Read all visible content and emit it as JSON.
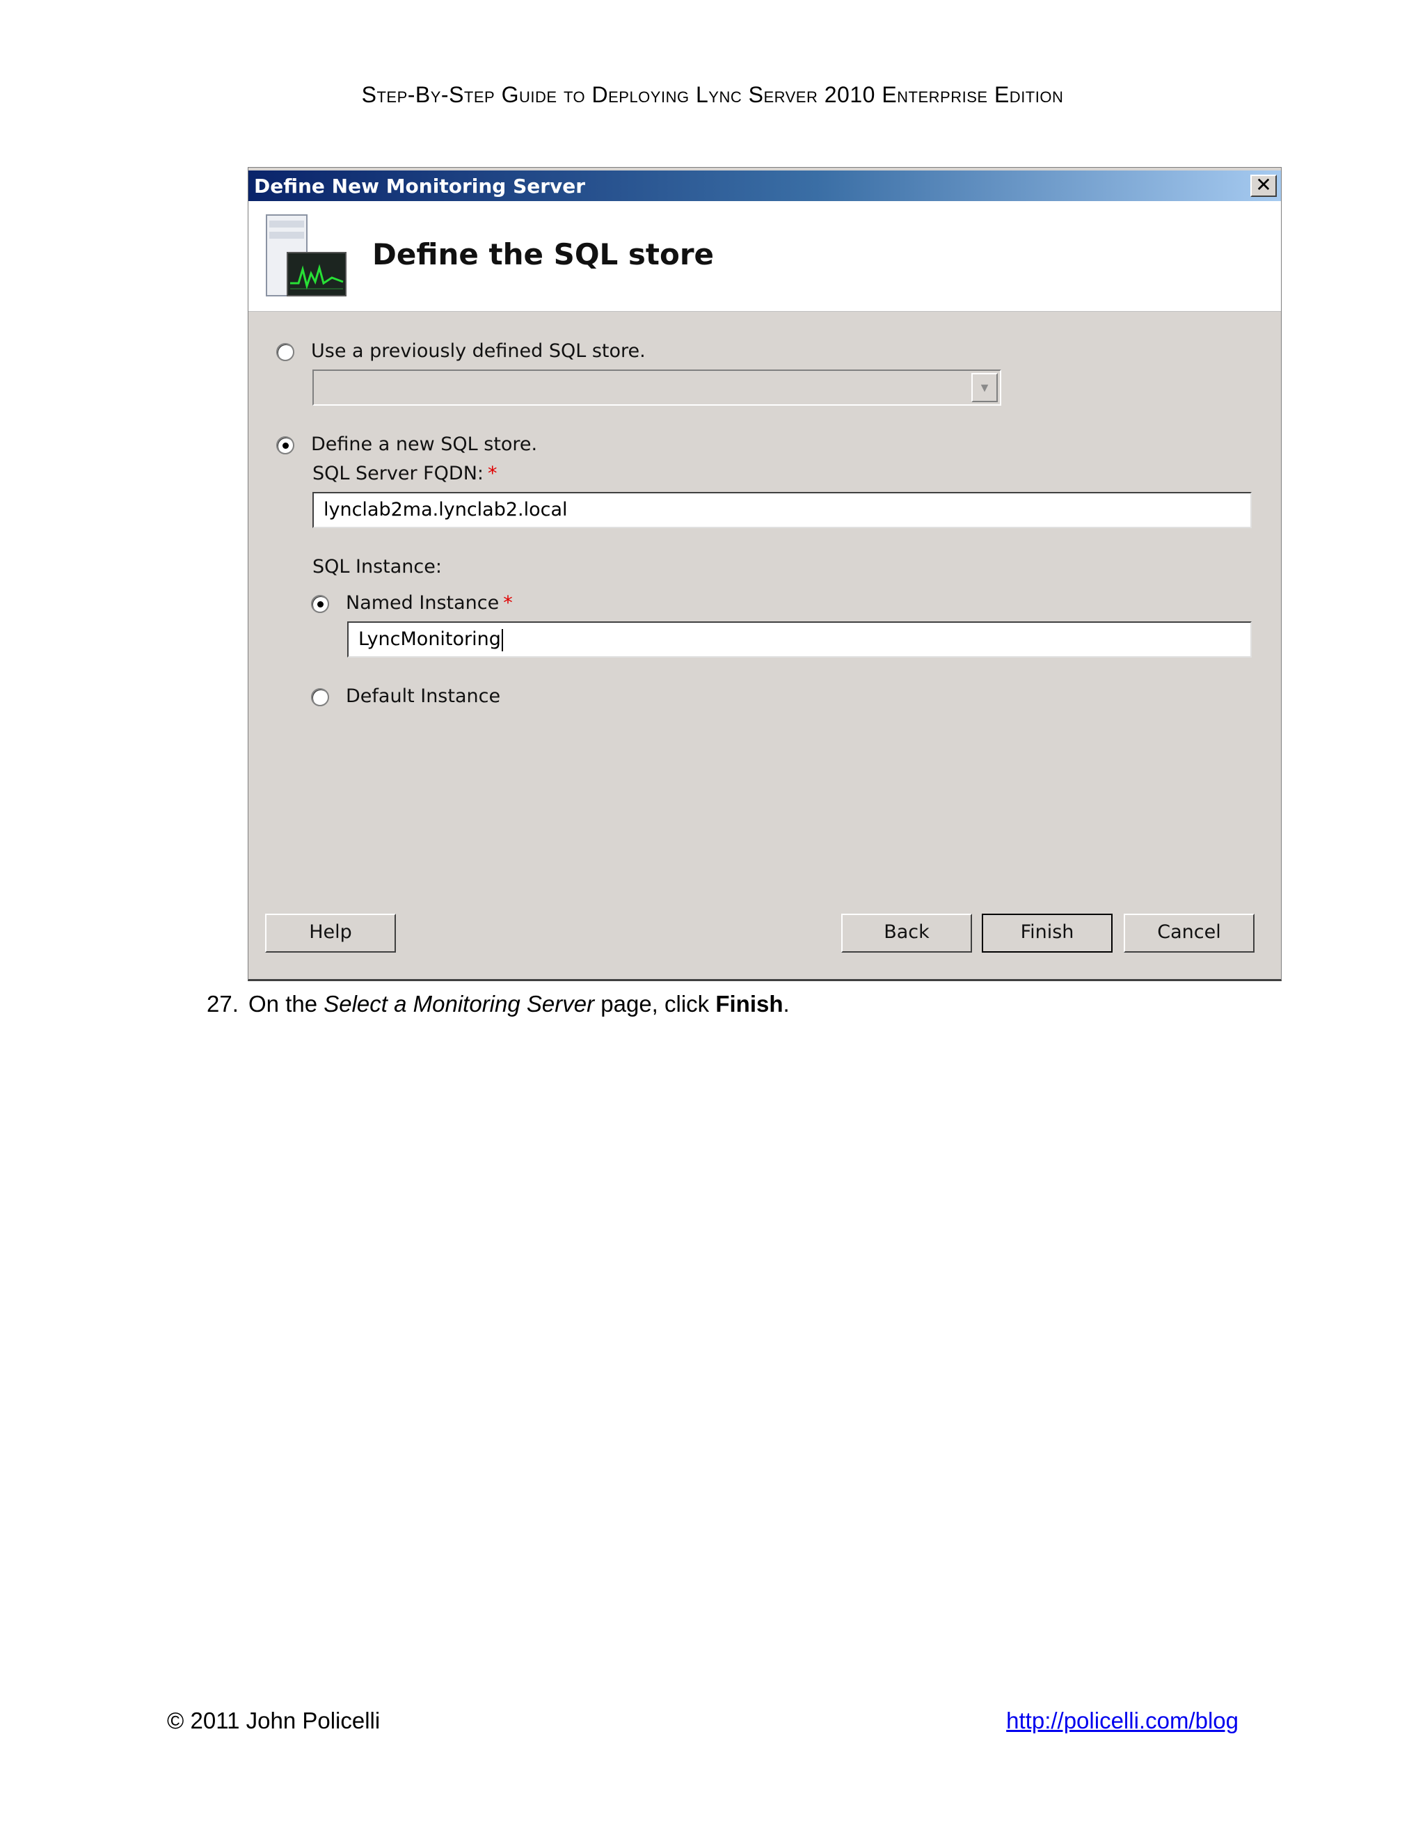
{
  "document": {
    "header": "Step-By-Step Guide to Deploying Lync Server 2010 Enterprise Edition",
    "instruction": {
      "number": "27.",
      "prefix": "On the ",
      "page_name": "Select a Monitoring Server",
      "middle": " page, click ",
      "action": "Finish",
      "suffix": "."
    },
    "footer": {
      "copyright": "© 2011 John Policelli",
      "link": "http://policelli.com/blog"
    }
  },
  "dialog": {
    "title": "Define New Monitoring Server",
    "close_glyph": "✕",
    "heading": "Define the SQL store",
    "icon": "monitoring-server-icon",
    "options": {
      "use_previous_label": "Use a previously defined SQL store.",
      "use_previous_checked": false,
      "previous_store_value": "",
      "define_new_label": "Define a new SQL store.",
      "define_new_checked": true
    },
    "fqdn": {
      "label": "SQL Server FQDN:",
      "required_mark": "*",
      "value": "lynclab2ma.lynclab2.local"
    },
    "instance": {
      "label": "SQL Instance:",
      "named_label": "Named Instance",
      "named_checked": true,
      "required_mark": "*",
      "named_value": "LyncMonitoring",
      "default_label": "Default Instance",
      "default_checked": false
    },
    "buttons": {
      "help": "Help",
      "back": "Back",
      "finish": "Finish",
      "cancel": "Cancel"
    },
    "colors": {
      "title_bar_start": "#0a246a",
      "title_bar_end": "#a6caf0",
      "dialog_background": "#d9d5d1",
      "required": "#e00000"
    }
  }
}
